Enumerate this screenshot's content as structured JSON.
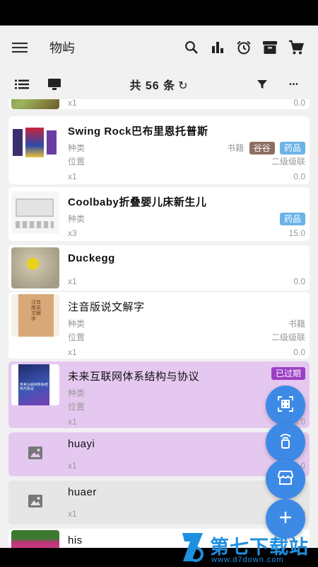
{
  "app": {
    "title": "物屿"
  },
  "toolbar": {
    "count_label": "共 56 条",
    "refresh_glyph": "↻",
    "more_glyph": "•••"
  },
  "colors": {
    "accent": "#3d8ae6",
    "tag_brown": "#8e6e63",
    "tag_blue": "#6bb3e9",
    "tag_purple": "#9c3fc4",
    "expired_bg": "#e5c8ef"
  },
  "cards": [
    {
      "qty": "x1",
      "price": "0.0"
    },
    {
      "name": "Swing Rock巴布里恩托普斯",
      "kind_label": "种类",
      "kind_value": "书籍",
      "tags": [
        "谷谷",
        "药品"
      ],
      "loc_label": "位置",
      "loc_value": "二级级联",
      "qty": "x1",
      "price": "0.0"
    },
    {
      "name": "Coolbaby折叠婴儿床新生儿",
      "kind_label": "种类",
      "tags": [
        "药品"
      ],
      "qty": "x3",
      "price": "15.0"
    },
    {
      "name": "Duckegg",
      "qty": "x1",
      "price": "0.0"
    },
    {
      "name": "注音版说文解字",
      "kind_label": "种类",
      "kind_value": "书籍",
      "loc_label": "位置",
      "loc_value": "二级级联",
      "qty": "x1",
      "price": "0.0"
    },
    {
      "name": "未来互联网体系结构与协议",
      "badge": "已过期",
      "kind_label": "种类",
      "loc_label": "位置",
      "qty": "x1",
      "price": "0.0"
    },
    {
      "name": "huayi",
      "qty": "x1",
      "price": "0.0"
    },
    {
      "name": "huaer",
      "qty": "x1",
      "price": "0.0"
    },
    {
      "name": "his"
    }
  ],
  "thumb_texts": {
    "book_cover": "未来互联网体系结构与协议",
    "dict_cover": "注音版说文解字"
  },
  "watermark": {
    "brand": "第七下载站",
    "url": "www.d7down.com"
  }
}
